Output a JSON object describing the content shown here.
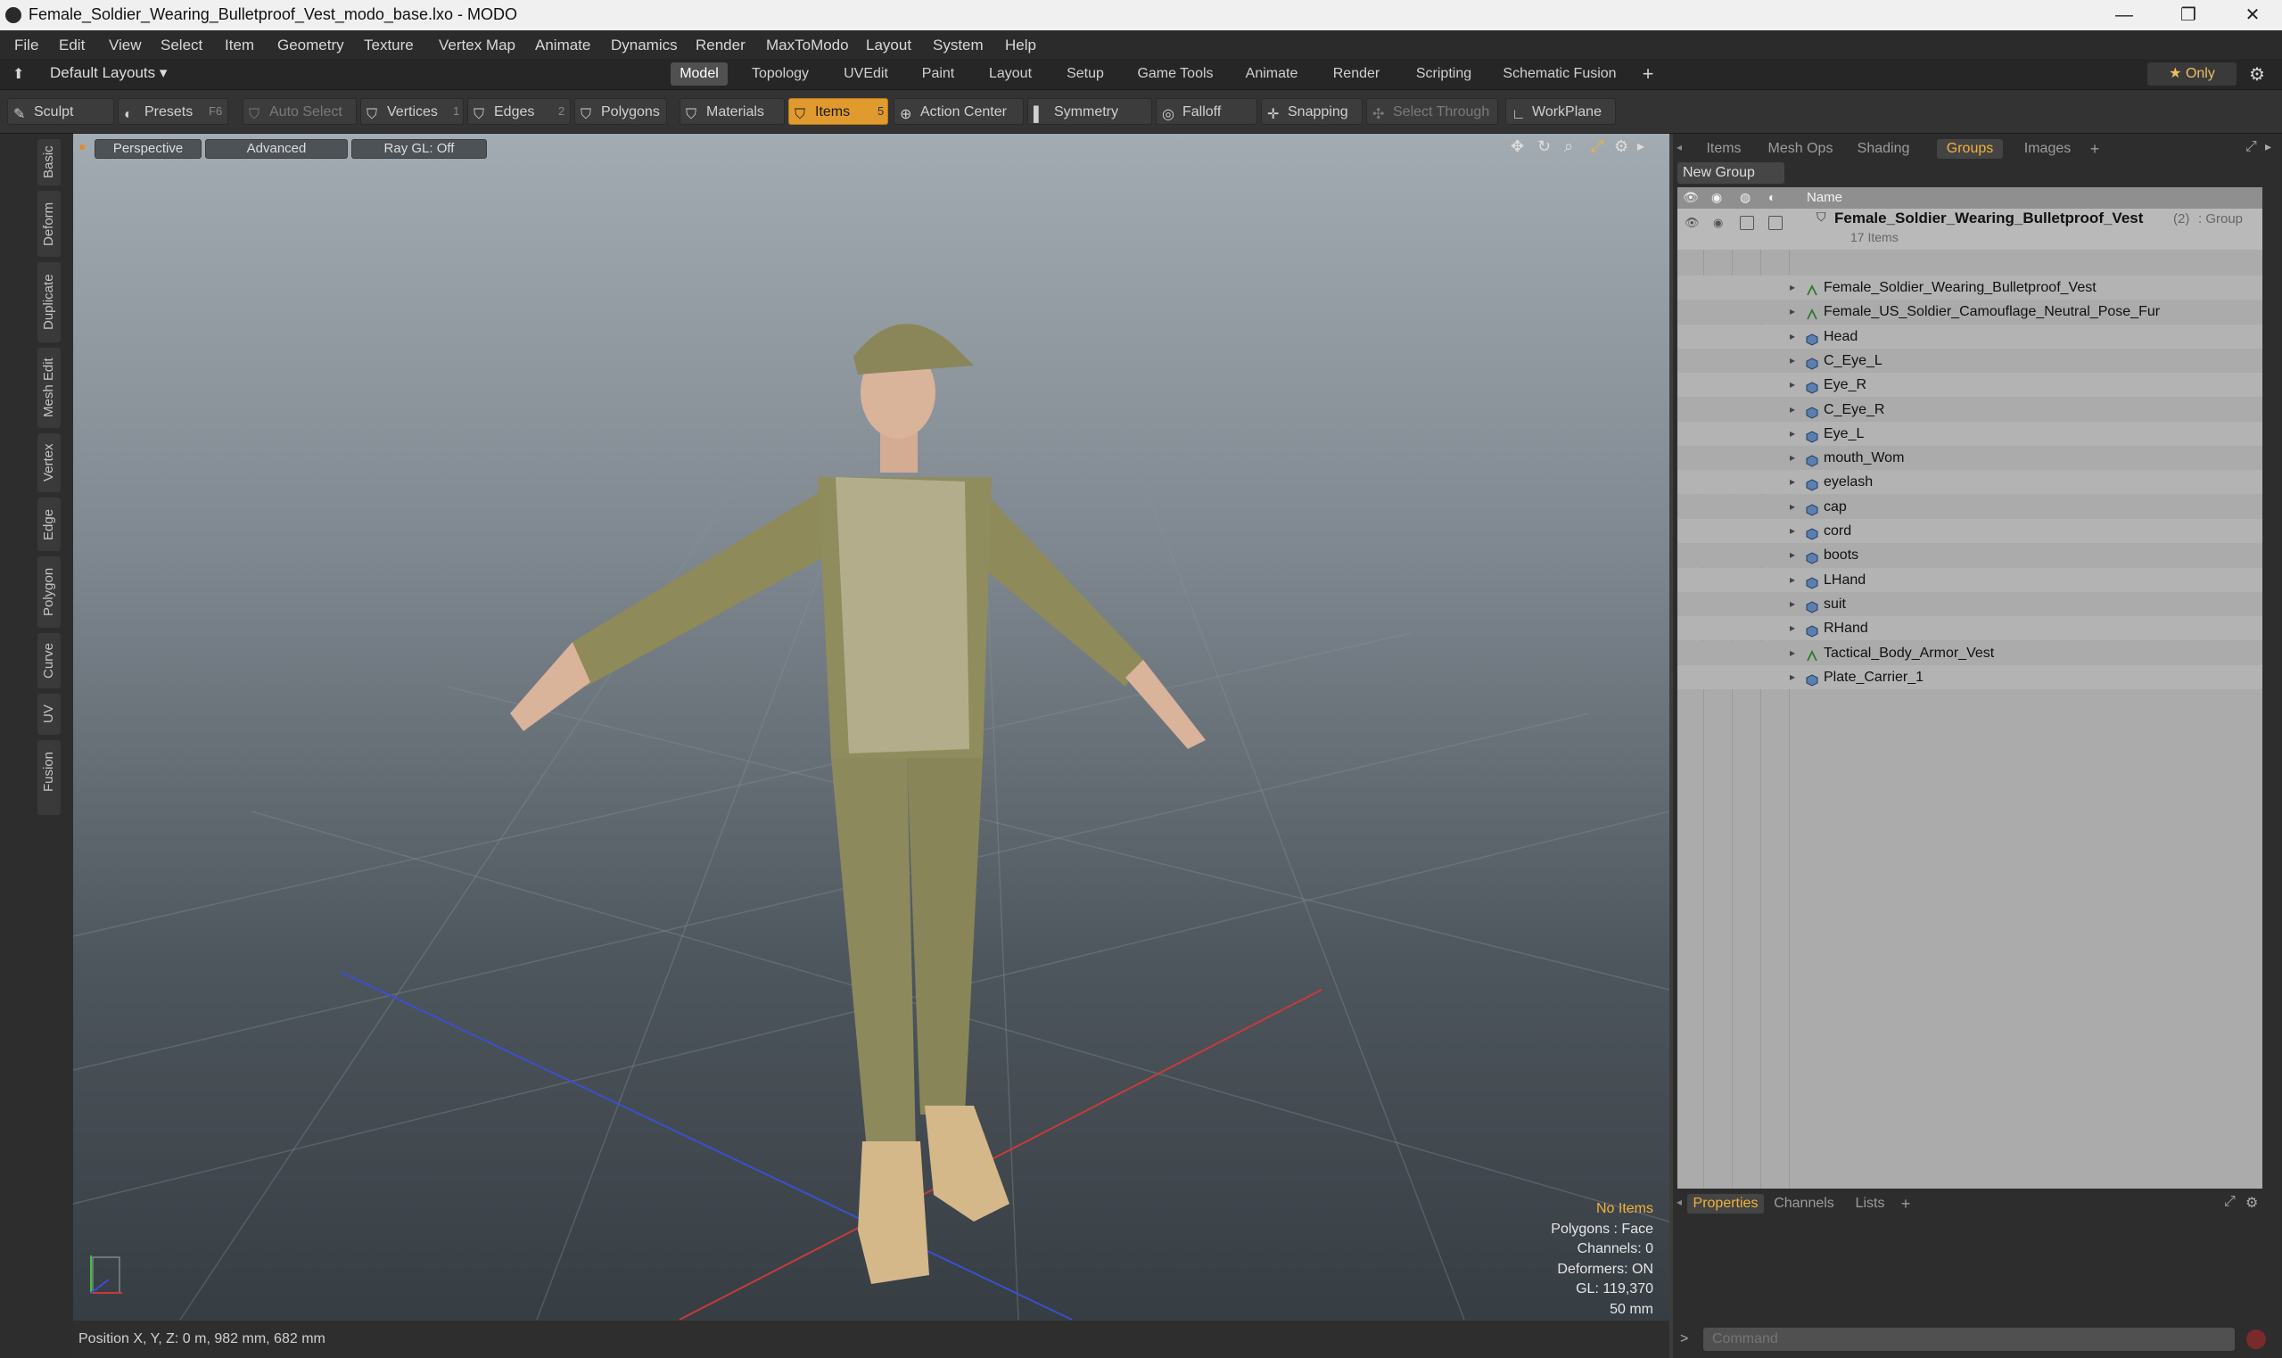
{
  "window": {
    "title": "Female_Soldier_Wearing_Bulletproof_Vest_modo_base.lxo - MODO",
    "minimize": "—",
    "maximize": "❐",
    "close": "✕"
  },
  "menu": [
    "File",
    "Edit",
    "View",
    "Select",
    "Item",
    "Geometry",
    "Texture",
    "Vertex Map",
    "Animate",
    "Dynamics",
    "Render",
    "MaxToModo",
    "Layout",
    "System",
    "Help"
  ],
  "layoutbar": {
    "layouts_label": "Default Layouts ▾",
    "tabs": [
      "Model",
      "Topology",
      "UVEdit",
      "Paint",
      "Layout",
      "Setup",
      "Game Tools",
      "Animate",
      "Render",
      "Scripting",
      "Schematic Fusion"
    ],
    "active_tab": "Model",
    "add": "+",
    "only_label": "★  Only"
  },
  "toolbar": {
    "sculpt": "Sculpt",
    "presets": "Presets",
    "presets_key": "F6",
    "auto_select": "Auto Select",
    "vertices": "Vertices",
    "vertices_key": "1",
    "edges": "Edges",
    "edges_key": "2",
    "polygons": "Polygons",
    "materials": "Materials",
    "items": "Items",
    "items_key": "5",
    "action_center": "Action Center",
    "symmetry": "Symmetry",
    "falloff": "Falloff",
    "snapping": "Snapping",
    "select_through": "Select Through",
    "workplane": "WorkPlane"
  },
  "left_tabs": [
    "Basic",
    "Deform",
    "Duplicate",
    "Mesh Edit",
    "Vertex",
    "Edge",
    "Polygon",
    "Curve",
    "UV",
    "Fusion"
  ],
  "viewport": {
    "perspective": "Perspective",
    "advanced": "Advanced",
    "raygl": "Ray GL: Off",
    "stats": {
      "no_items": "No Items",
      "polygons": "Polygons : Face",
      "channels": "Channels: 0",
      "deformers": "Deformers: ON",
      "gl": "GL: 119,370",
      "scale": "50 mm"
    }
  },
  "statusbar": {
    "position": "Position X, Y, Z:   0 m, 982 mm, 682 mm"
  },
  "right_panel": {
    "tabs": [
      "Items",
      "Mesh Ops",
      "Shading",
      "Groups",
      "Images"
    ],
    "active_tab": "Groups",
    "add": "+",
    "new_group": "New Group",
    "name_header": "Name",
    "group": {
      "name": "Female_Soldier_Wearing_Bulletproof_Vest",
      "count": "(2)",
      "type": ": Group",
      "sub": "17 Items"
    },
    "items": [
      {
        "label": "Female_Soldier_Wearing_Bulletproof_Vest",
        "icon": "locator-icon"
      },
      {
        "label": "Female_US_Soldier_Camouflage_Neutral_Pose_Fur",
        "icon": "locator-icon"
      },
      {
        "label": "Head",
        "icon": "mesh-icon"
      },
      {
        "label": "C_Eye_L",
        "icon": "mesh-icon"
      },
      {
        "label": "Eye_R",
        "icon": "mesh-icon"
      },
      {
        "label": "C_Eye_R",
        "icon": "mesh-icon"
      },
      {
        "label": "Eye_L",
        "icon": "mesh-icon"
      },
      {
        "label": "mouth_Wom",
        "icon": "mesh-icon"
      },
      {
        "label": "eyelash",
        "icon": "mesh-icon"
      },
      {
        "label": "cap",
        "icon": "mesh-icon"
      },
      {
        "label": "cord",
        "icon": "mesh-icon"
      },
      {
        "label": "boots",
        "icon": "mesh-icon"
      },
      {
        "label": "LHand",
        "icon": "mesh-icon"
      },
      {
        "label": "suit",
        "icon": "mesh-icon"
      },
      {
        "label": "RHand",
        "icon": "mesh-icon"
      },
      {
        "label": "Tactical_Body_Armor_Vest",
        "icon": "locator-icon"
      },
      {
        "label": "Plate_Carrier_1",
        "icon": "mesh-icon"
      }
    ],
    "bottom_tabs": [
      "Properties",
      "Channels",
      "Lists"
    ],
    "bottom_active": "Properties",
    "command_placeholder": "Command",
    "cmd_prompt": ">"
  },
  "colors": {
    "accent": "#f0b23a",
    "items_active": "#e09a2e",
    "list_bg": "#ababab"
  }
}
